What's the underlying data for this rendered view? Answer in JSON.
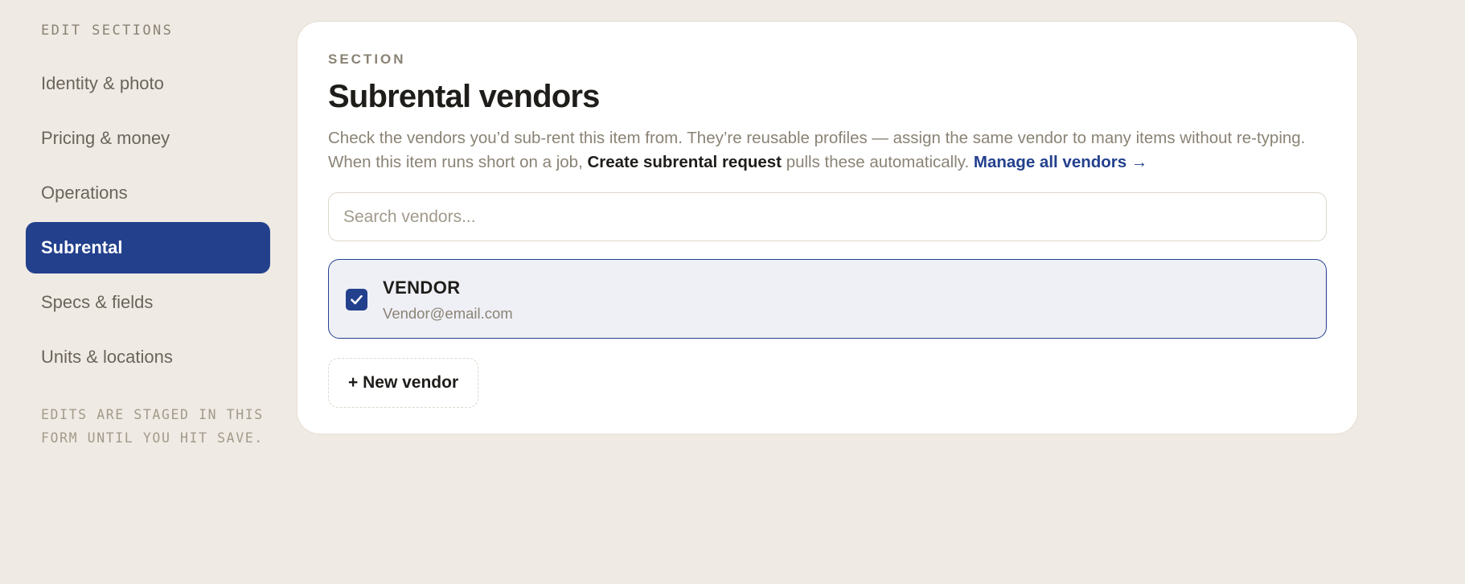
{
  "sidebar": {
    "heading": "EDIT SECTIONS",
    "items": [
      {
        "label": "Identity & photo",
        "active": false
      },
      {
        "label": "Pricing & money",
        "active": false
      },
      {
        "label": "Operations",
        "active": false
      },
      {
        "label": "Subrental",
        "active": true
      },
      {
        "label": "Specs & fields",
        "active": false
      },
      {
        "label": "Units & locations",
        "active": false
      }
    ],
    "note": "EDITS ARE STAGED IN THIS FORM UNTIL YOU HIT SAVE."
  },
  "section": {
    "eyebrow": "SECTION",
    "title": "Subrental vendors",
    "description_part1": "Check the vendors you’d sub-rent this item from. They’re reusable profiles — assign the same vendor to many items without re-typing. When this item runs short on a job, ",
    "description_strong": "Create subrental request",
    "description_part2": " pulls these automatically. ",
    "manage_link": "Manage all vendors →"
  },
  "search": {
    "placeholder": "Search vendors...",
    "value": ""
  },
  "vendors": [
    {
      "name": "VENDOR",
      "email": "Vendor@email.com",
      "checked": true
    }
  ],
  "new_vendor_label": "+ New vendor",
  "colors": {
    "accent": "#23408d",
    "background": "#efeae3",
    "muted_text": "#8a8375",
    "selected_row_bg": "#eff0f5"
  },
  "icons": {
    "checkbox": "checkmark-icon"
  }
}
